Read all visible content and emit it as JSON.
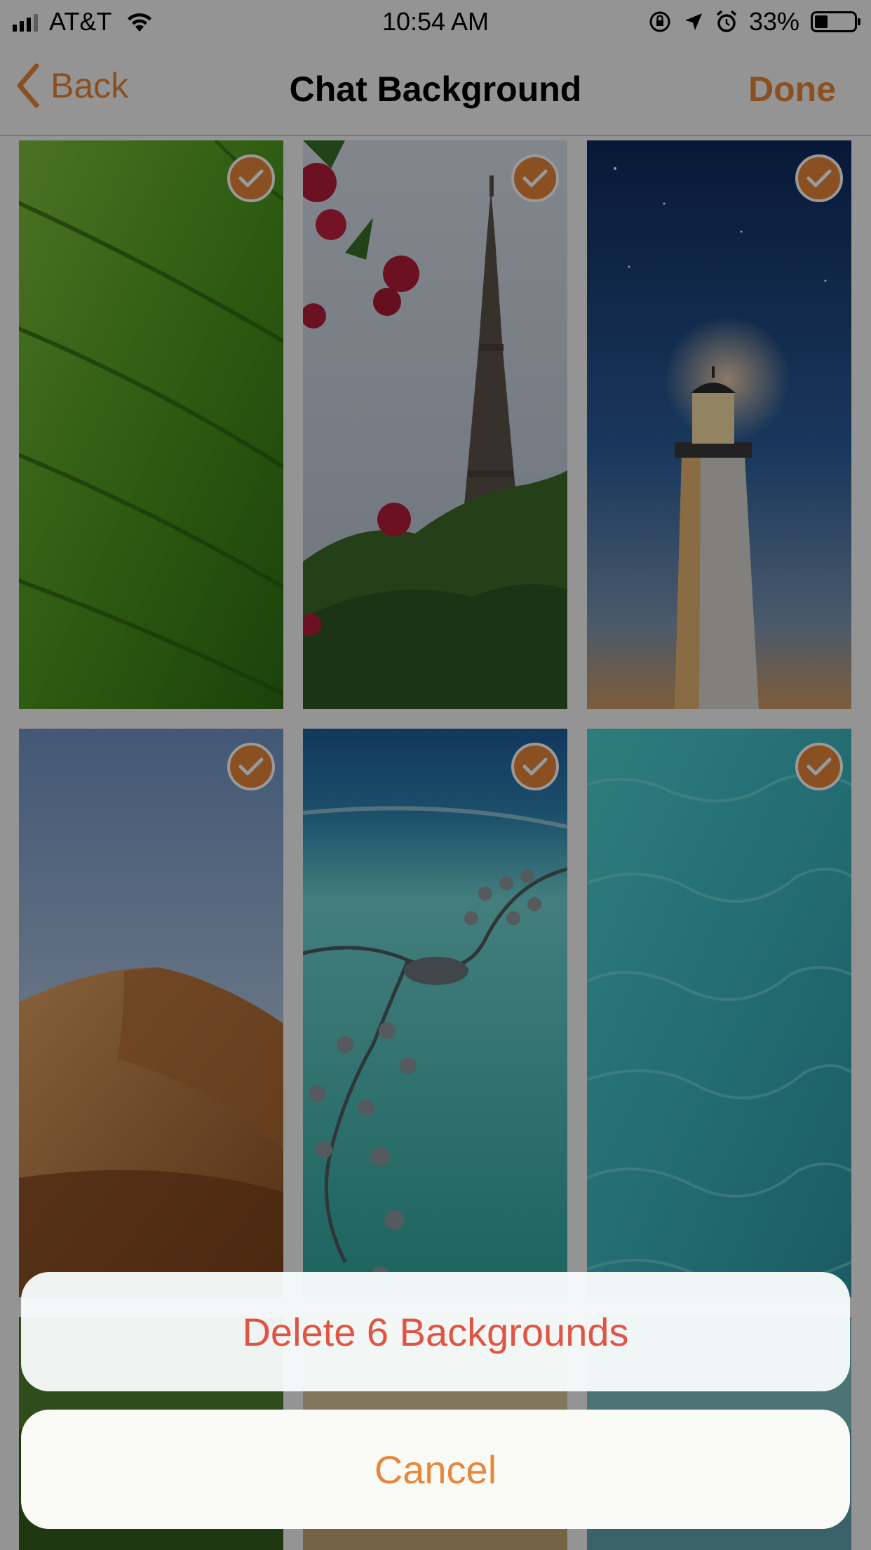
{
  "status_bar": {
    "carrier": "AT&T",
    "time": "10:54 AM",
    "battery_percent": "33%",
    "battery_level": 0.33,
    "icons": [
      "signal-icon",
      "wifi-icon",
      "orientation-lock-icon",
      "location-arrow-icon",
      "alarm-icon",
      "battery-icon"
    ]
  },
  "navbar": {
    "back_label": "Back",
    "title": "Chat Background",
    "done_label": "Done"
  },
  "colors": {
    "accent": "#e8863a",
    "destructive": "#e05444"
  },
  "backgrounds": [
    {
      "name": "leaf",
      "selected": true
    },
    {
      "name": "eiffel-tower",
      "selected": true
    },
    {
      "name": "lighthouse",
      "selected": true
    },
    {
      "name": "desert-dune",
      "selected": true
    },
    {
      "name": "overwater-villas",
      "selected": true
    },
    {
      "name": "turquoise-water",
      "selected": true
    }
  ],
  "action_sheet": {
    "delete_label": "Delete 6 Backgrounds",
    "cancel_label": "Cancel"
  }
}
